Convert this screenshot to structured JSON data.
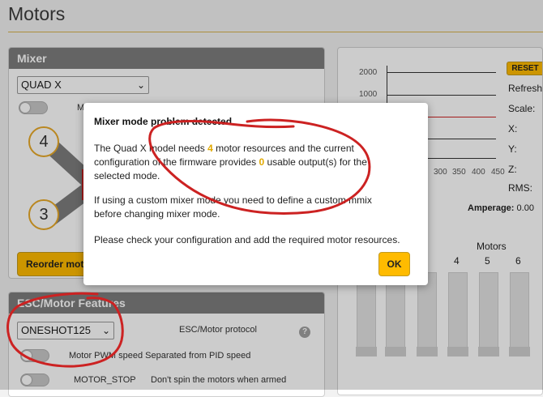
{
  "page": {
    "title": "Motors"
  },
  "mixer": {
    "header": "Mixer",
    "selected_mode": "QUAD X",
    "toggle_label": "M",
    "motors_visible": [
      "4",
      "3"
    ],
    "reorder_label": "Reorder mot"
  },
  "esc": {
    "header": "ESC/Motor Features",
    "protocol_value": "ONESHOT125",
    "protocol_label": "ESC/Motor protocol",
    "pwm_label": "Motor PWM speed Separated from PID speed",
    "motor_stop_name": "MOTOR_STOP",
    "motor_stop_desc": "Don't spin the motors when armed"
  },
  "graph": {
    "y_ticks": [
      "2000",
      "1000"
    ],
    "x_ticks": [
      "300",
      "350",
      "400",
      "450"
    ],
    "reset_label": "RESET",
    "stats": [
      "Refresh",
      "Scale:",
      "X:",
      "Y:",
      "Z:",
      "RMS:"
    ],
    "amperage_label": "Amperage:",
    "amperage_value": "0.00"
  },
  "motors": {
    "title": "Motors",
    "numbers": [
      "4",
      "5",
      "6"
    ]
  },
  "modal": {
    "title": "Mixer mode problem detected",
    "p1_a": "The Quad X model needs ",
    "p1_needed": "4",
    "p1_b": " motor resources and the current",
    "p1_c": "configuration of the firmware provides ",
    "p1_provided": "0",
    "p1_d": " usable output(s) for the",
    "p1_e": "selected mode.",
    "p2_a": "If using a custom mixer mode you need to define a custom mmix",
    "p2_b": "before changing mixer mode.",
    "p3": "Please check your configuration and add the required motor resources.",
    "ok_label": "OK"
  },
  "colors": {
    "accent": "#ffbb00",
    "highlight": "#e0a800",
    "annotation": "#cc2222",
    "header_bg": "#7e7e7e"
  }
}
